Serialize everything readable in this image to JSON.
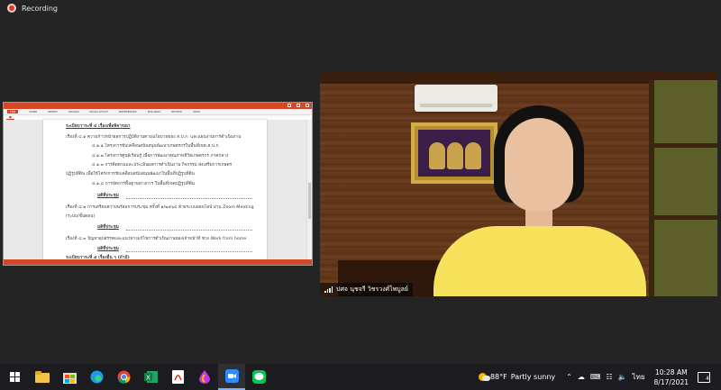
{
  "recording": {
    "label": "Recording"
  },
  "doc_window": {
    "ribbon_tabs": [
      "FILE",
      "HOME",
      "INSERT",
      "DESIGN",
      "PAGE LAYOUT",
      "REFERENCES",
      "MAILINGS",
      "REVIEW",
      "VIEW"
    ],
    "lines": [
      "ระเบียบวาระที่ ๔  เรื่องเพื่อพิจารณา",
      "เรื่องที่ ๔.๑  ความก้าวหน้าผลการปฏิบัติงานตามนโยบายของ ส.ป.ก. และแผนงานการดำเนินงาน",
      "๔.๑.๑ โครงการขับเคลื่อนสนับสนุนพัฒนาเกษตรกรในพื้นที่เขต ส.ป.ก.",
      "๔.๑.๒ โครงการศูนย์เรียนรู้ เพื่อการพัฒนาคุณภาพชีวิตเกษตรกร ภาคกลาง",
      "๔.๑.๓ การติดตามและประเมินผลการดำเนินงาน กิจกรรม ส่งเสริมการเกษตร",
      "ปฏิรูปที่ดิน เพื่อให้โครงการขับเคลื่อนสนับสนุนพัฒนาในพื้นที่ปฏิรูปที่ดิน",
      "๔.๑.๔ การจัดการพื้นฐานทางการ ในพื้นที่เขตปฏิรูปที่ดิน",
      "มติที่ประชุม",
      "เรื่องที่ ๔.๒  การเตรียมความพร้อมการประชุม ครั้งที่ ๑/๒๕๖๔ ด้วยระบบออนไลน์ ผ่าน Zoom Meeting",
      "(ระบบ/ขั้นตอน)",
      "มติที่ประชุม",
      "เรื่องที่ ๔.๓  ปัญหาอุปสรรคและแนวทางแก้ไขการดำเนินงานของเจ้าหน้าที่ ช่วง Work from home",
      "มติที่ประชุม",
      "ระเบียบวาระที่ ๕  เรื่องอื่น ๆ (ถ้ามี)"
    ]
  },
  "video": {
    "participant_name": "ปศจ นุชจรี วิชรวงศ์ไพบูลย์"
  },
  "taskbar": {
    "apps": [
      "start",
      "file-explorer",
      "microsoft-store",
      "edge",
      "chrome",
      "excel",
      "acrobat",
      "paint",
      "zoom",
      "line"
    ],
    "weather": {
      "temp": "88°F",
      "condition": "Partly sunny"
    },
    "language": "ไทย",
    "time": "10:28 AM",
    "date": "8/17/2021",
    "notification_count": "4"
  }
}
